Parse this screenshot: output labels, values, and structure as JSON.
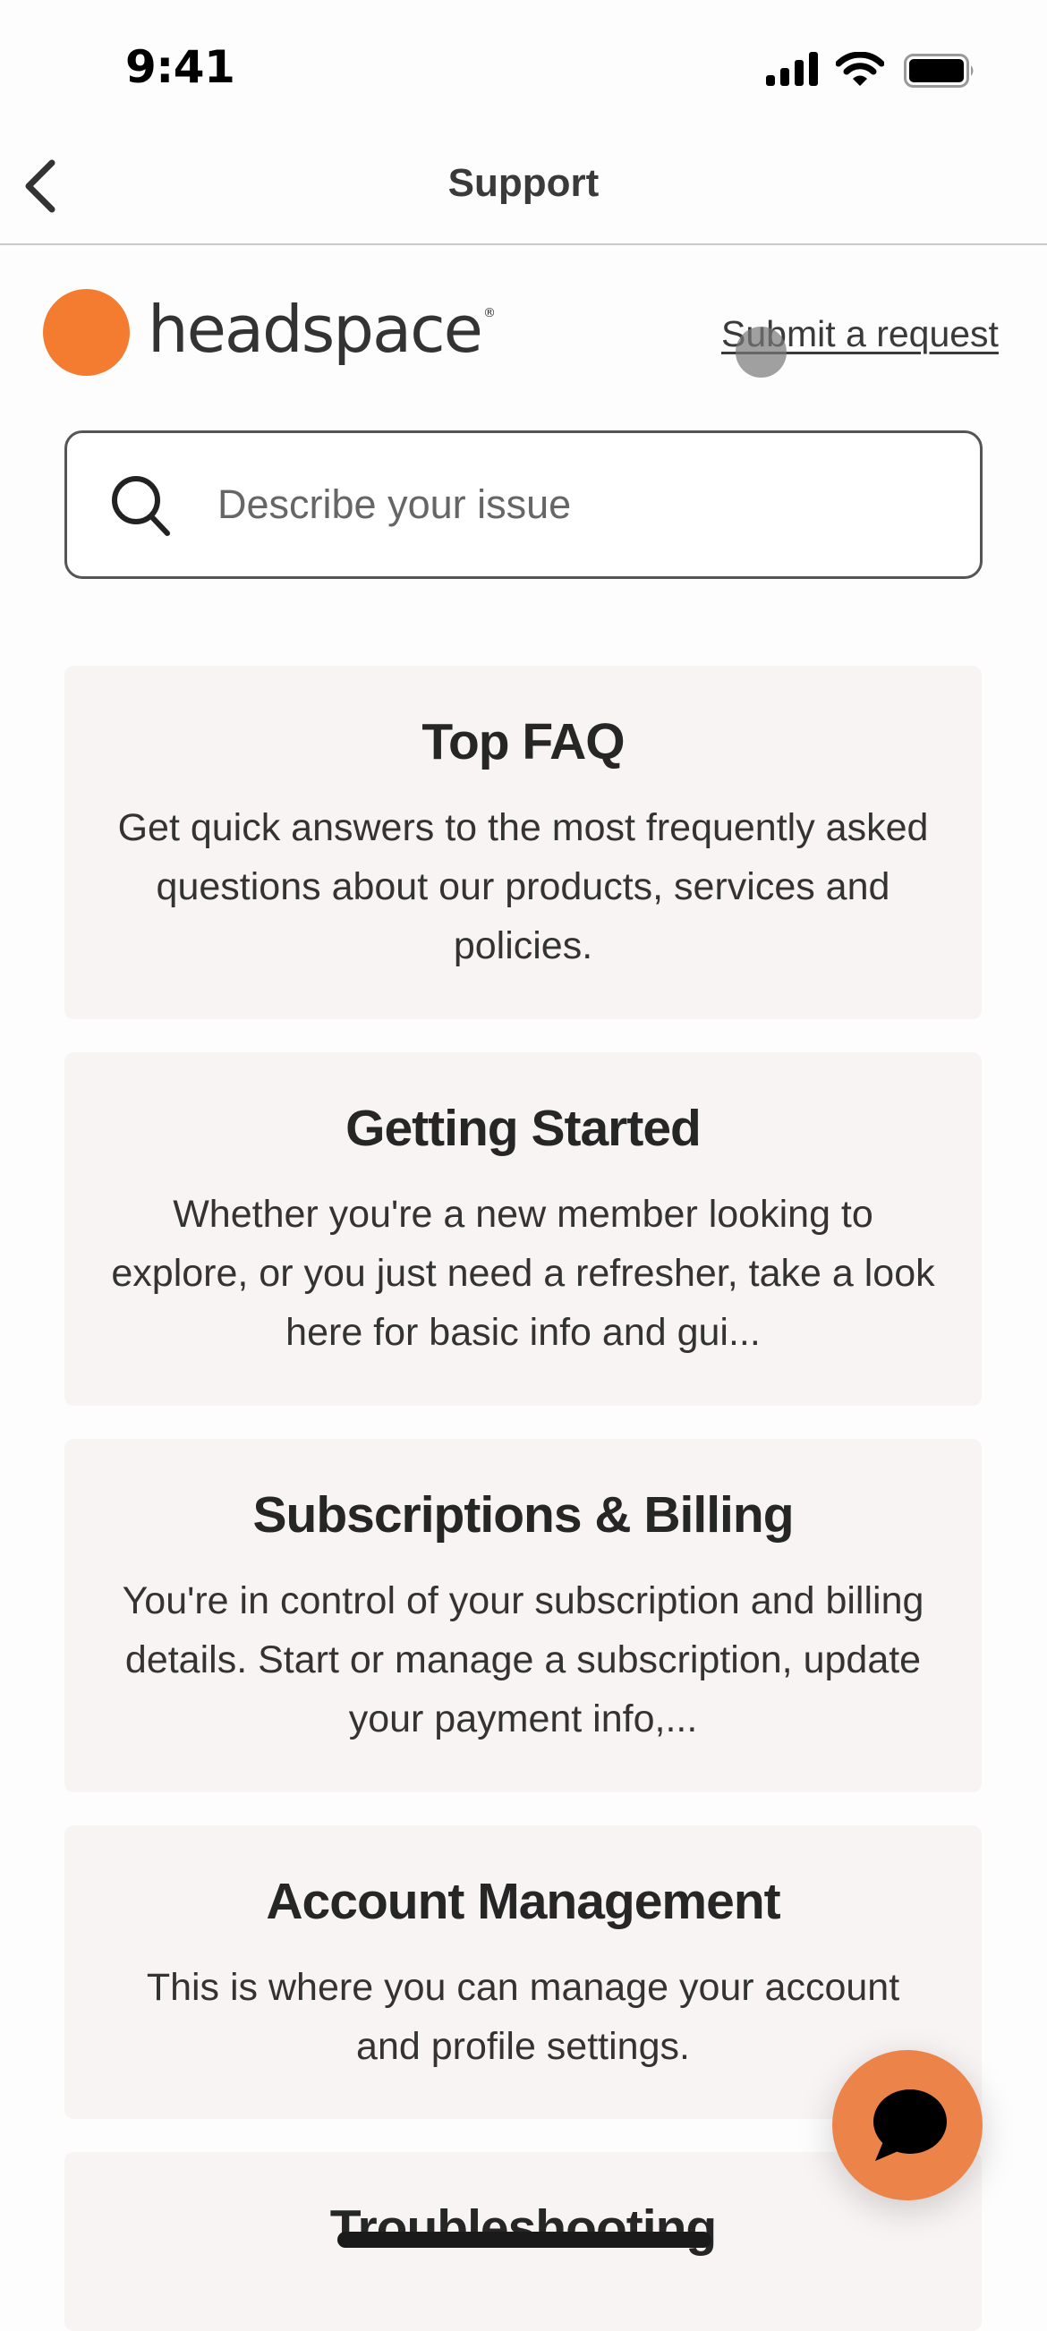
{
  "status_bar": {
    "time": "9:41",
    "icons": [
      "cellular-signal-icon",
      "wifi-icon",
      "battery-icon"
    ]
  },
  "nav": {
    "back_icon": "chevron-left-icon",
    "title": "Support"
  },
  "brand": {
    "name": "headspace",
    "registered_mark": "®",
    "accent_color": "#f47c30"
  },
  "submit_request_label": "Submit a request",
  "search": {
    "icon": "search-icon",
    "placeholder": "Describe your issue",
    "value": ""
  },
  "categories": [
    {
      "title": "Top FAQ",
      "description": "Get quick answers to the most frequently asked questions about our products, services and policies."
    },
    {
      "title": "Getting Started",
      "description": "Whether you're a new member looking to explore, or you just need a refresher, take a look here for basic info and gui..."
    },
    {
      "title": "Subscriptions & Billing",
      "description": "You're in control of your subscription and billing details. Start or manage a subscription, update your payment info,..."
    },
    {
      "title": "Account Management",
      "description": "This is where you can manage your account and profile settings."
    },
    {
      "title": "Troubleshooting",
      "description": ""
    }
  ],
  "chat_button": {
    "icon": "chat-bubble-icon",
    "color": "#ec844a"
  }
}
